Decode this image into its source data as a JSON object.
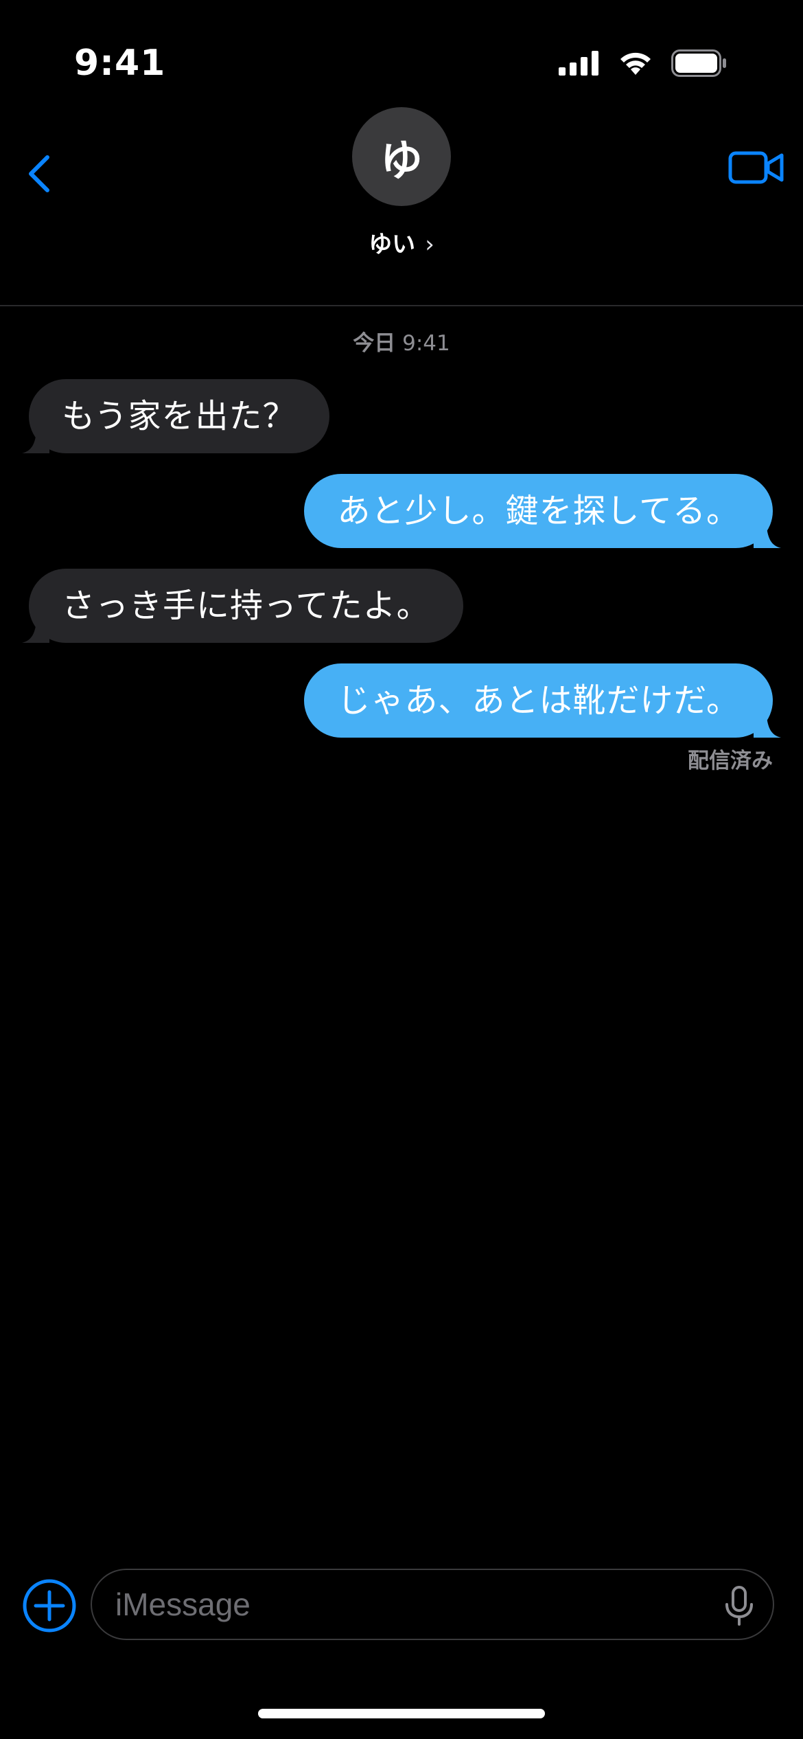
{
  "status": {
    "time": "9:41"
  },
  "header": {
    "avatar_initial": "ゆ",
    "contact_name": "ゆい",
    "contact_chevron": "›",
    "back_icon": "chevron-left-icon",
    "video_icon": "video-camera-icon"
  },
  "thread": {
    "timestamp_day": "今日",
    "timestamp_time": "9:41",
    "messages": [
      {
        "direction": "incoming",
        "text": "もう家を出た？"
      },
      {
        "direction": "outgoing",
        "text": "あと少し。鍵を探してる。"
      },
      {
        "direction": "incoming",
        "text": "さっき手に持ってたよ。"
      },
      {
        "direction": "outgoing",
        "text": "じゃあ、あとは靴だけだ。"
      }
    ],
    "delivered_label": "配信済み"
  },
  "composer": {
    "placeholder": "iMessage",
    "value": "",
    "plus_icon": "plus-circle-icon",
    "mic_icon": "microphone-icon"
  },
  "colors": {
    "accent": "#0a84ff",
    "outgoing_bubble": "#47b0f5",
    "incoming_bubble": "#262629",
    "background": "#000000"
  }
}
